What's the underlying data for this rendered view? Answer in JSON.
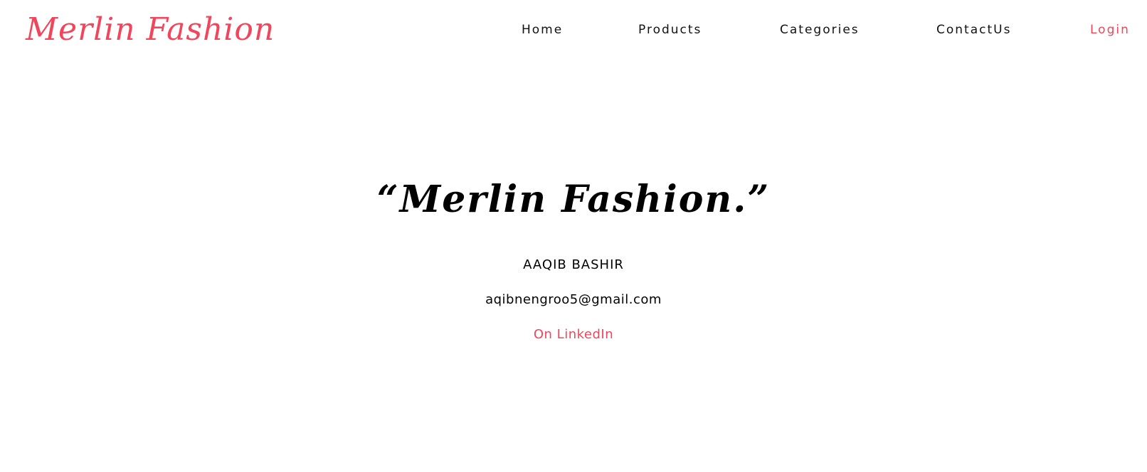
{
  "brand": {
    "logo_text": "Merlin Fashion",
    "accent_color": "#f0455a"
  },
  "nav": {
    "items": [
      {
        "label": "Home"
      },
      {
        "label": "Products"
      },
      {
        "label": "Categories"
      },
      {
        "label": "ContactUs"
      },
      {
        "label": "Login"
      }
    ]
  },
  "hero": {
    "title": "“Merlin Fashion.”",
    "name": "AAQIB BASHIR",
    "email": "aqibnengroo5@gmail.com",
    "linkedin_label": "On LinkedIn"
  }
}
